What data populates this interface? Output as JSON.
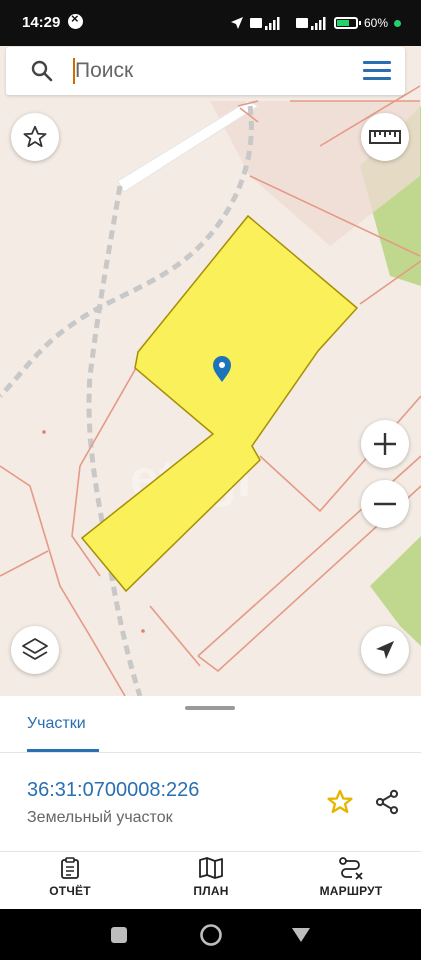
{
  "status": {
    "time": "14:29",
    "net1": "Vo LTE",
    "net1_top": "4G+",
    "net2": "Vo LTE",
    "battery": "60%"
  },
  "search": {
    "placeholder": "Поиск"
  },
  "map": {
    "plot_color": "#f9f05a",
    "plot_border": "#b8a000",
    "pin_color": "#1f74b8",
    "watermark": "etagi"
  },
  "sheet": {
    "tab_label": "Участки",
    "cadastral_number": "36:31:0700008:226",
    "property_type": "Земельный участок"
  },
  "bottom_nav": {
    "report": "ОТЧЁТ",
    "plan": "ПЛАН",
    "route": "МАРШРУТ"
  },
  "colors": {
    "accent": "#2a6fb1",
    "star": "#e7b400"
  }
}
